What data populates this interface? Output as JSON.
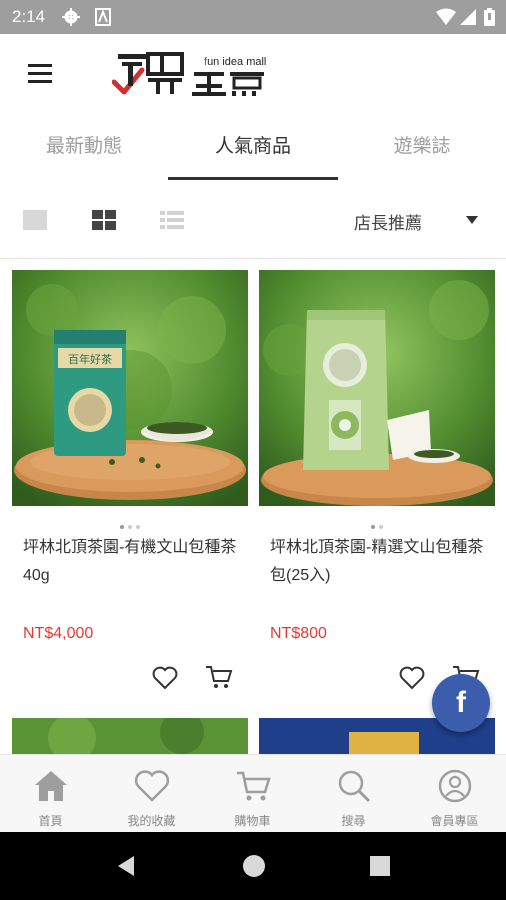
{
  "status_bar": {
    "time": "2:14"
  },
  "app": {
    "logo_brand": "玩買主意",
    "logo_sub": "fun idea mall"
  },
  "tabs": [
    {
      "label": "最新動態",
      "active": false
    },
    {
      "label": "人氣商品",
      "active": true
    },
    {
      "label": "遊樂誌",
      "active": false
    }
  ],
  "toolbar": {
    "sort_label": "店長推薦",
    "view_modes": [
      "single-view",
      "grid-view",
      "list-view"
    ],
    "active_view": "grid-view"
  },
  "products": [
    {
      "name": "坪林北頂茶園-有機文山包種茶 40g",
      "price": "NT$4,000",
      "can_label": "百年好茶",
      "image_dots": 3,
      "active_dot": 0
    },
    {
      "name": "坪林北頂茶園-精選文山包種茶包(25入)",
      "price": "NT$800",
      "image_dots": 2,
      "active_dot": 0
    }
  ],
  "bottom_nav": [
    {
      "label": "首頁",
      "icon": "home-icon"
    },
    {
      "label": "我的收藏",
      "icon": "heart-icon"
    },
    {
      "label": "購物車",
      "icon": "cart-icon"
    },
    {
      "label": "搜尋",
      "icon": "search-icon"
    },
    {
      "label": "會員專區",
      "icon": "user-icon"
    }
  ],
  "fab": {
    "label": "f",
    "icon": "facebook-icon"
  },
  "colors": {
    "price": "#e53935",
    "status_bar": "#9e9e9e",
    "facebook": "#3b5dab",
    "logo_red": "#d32f2f"
  }
}
